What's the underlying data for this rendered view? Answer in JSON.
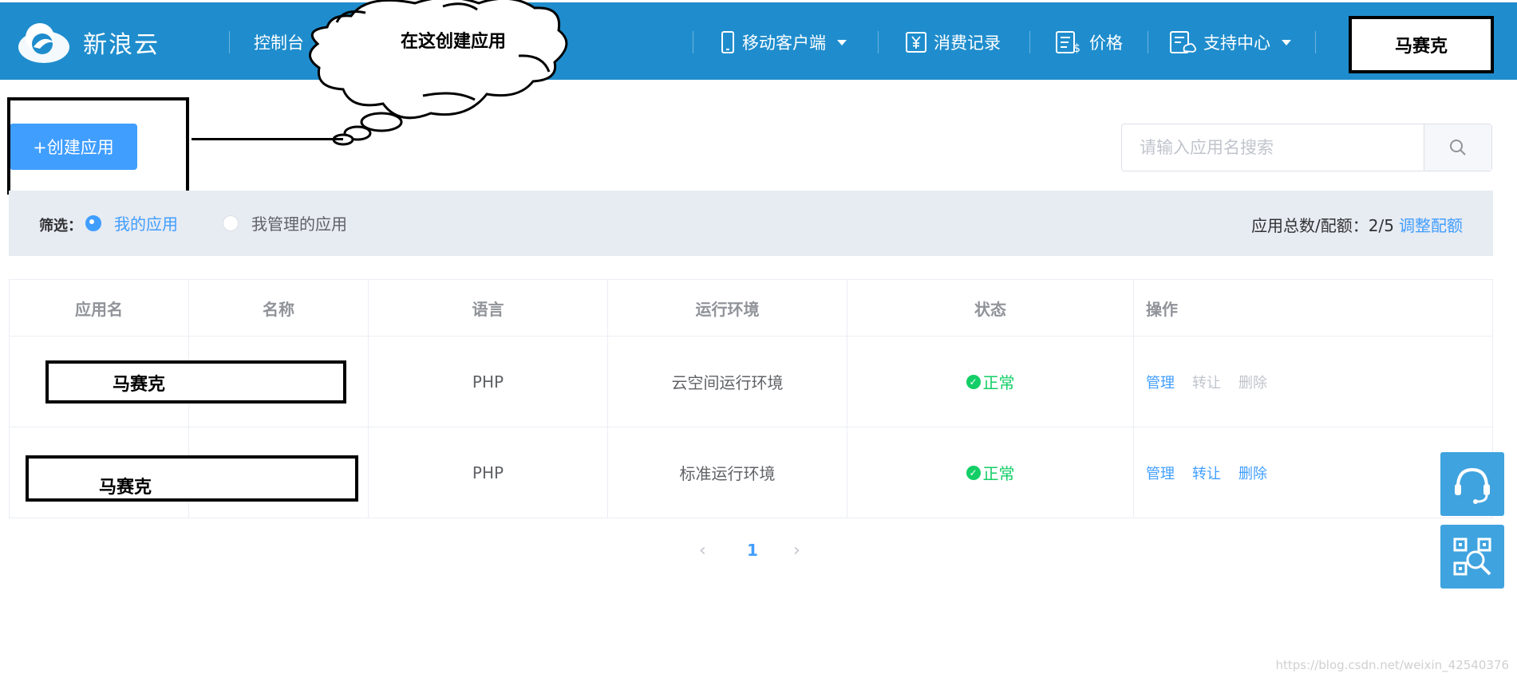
{
  "header": {
    "logo_text": "新浪云",
    "nav": {
      "console": "控制台",
      "mobile": "移动客户端",
      "billing": "消费记录",
      "price": "价格",
      "support": "支持中心"
    },
    "user": "马赛克"
  },
  "annotation": {
    "cloud_text": "在这创建应用"
  },
  "toolbar": {
    "create_label": "+创建应用",
    "search_placeholder": "请输入应用名搜索"
  },
  "filter": {
    "label": "筛选：",
    "option_mine": "我的应用",
    "option_managed": "我管理的应用",
    "selected": "我的应用",
    "quota_text": "应用总数/配额：2/5",
    "quota_link": "调整配额"
  },
  "table": {
    "headers": [
      "应用名",
      "名称",
      "语言",
      "运行环境",
      "状态",
      "操作"
    ],
    "rows": [
      {
        "name_mask": "马赛克",
        "language": "PHP",
        "env": "云空间运行环境",
        "status": "正常",
        "ops": [
          "管理",
          "转让",
          "删除"
        ]
      },
      {
        "name_mask": "马赛克",
        "language": "PHP",
        "env": "标准运行环境",
        "status": "正常",
        "ops": [
          "管理",
          "转让",
          "删除"
        ]
      }
    ]
  },
  "pagination": {
    "prev": "‹",
    "current": "1",
    "next": "›"
  },
  "watermark": "https://blog.csdn.net/weixin_42540376",
  "colors": {
    "nav_bg": "#1f8dcd",
    "primary": "#409eff",
    "success": "#13ce66",
    "filter_bg": "#e7ebf2",
    "float_btn": "#3fa3df"
  }
}
